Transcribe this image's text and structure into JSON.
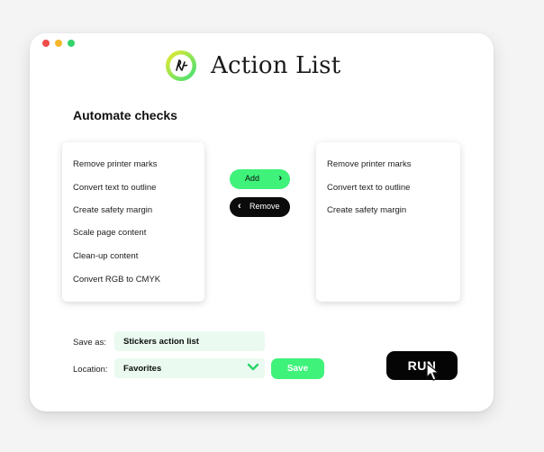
{
  "colors": {
    "accent_green": "#3ef27a",
    "light_green_field": "#eafaf0",
    "dark_button": "#0b0b0b",
    "window_dot_red": "#ef4b4b",
    "window_dot_yellow": "#f5b72b",
    "window_dot_green": "#35d36b"
  },
  "app": {
    "title": "Action List",
    "logo_icon": "action-list-logo-icon"
  },
  "section": {
    "title": "Automate checks"
  },
  "available_checks": [
    "Remove printer marks",
    "Convert text to outline",
    "Create safety margin",
    "Scale page content",
    "Clean-up content",
    "Convert RGB to CMYK"
  ],
  "selected_checks": [
    "Remove printer marks",
    "Convert text to outline",
    "Create safety margin"
  ],
  "buttons": {
    "add": "Add",
    "remove": "Remove",
    "save": "Save",
    "run": "RUN"
  },
  "form": {
    "save_as_label": "Save as:",
    "save_as_value": "Stickers action list",
    "location_label": "Location:",
    "location_value": "Favorites"
  }
}
